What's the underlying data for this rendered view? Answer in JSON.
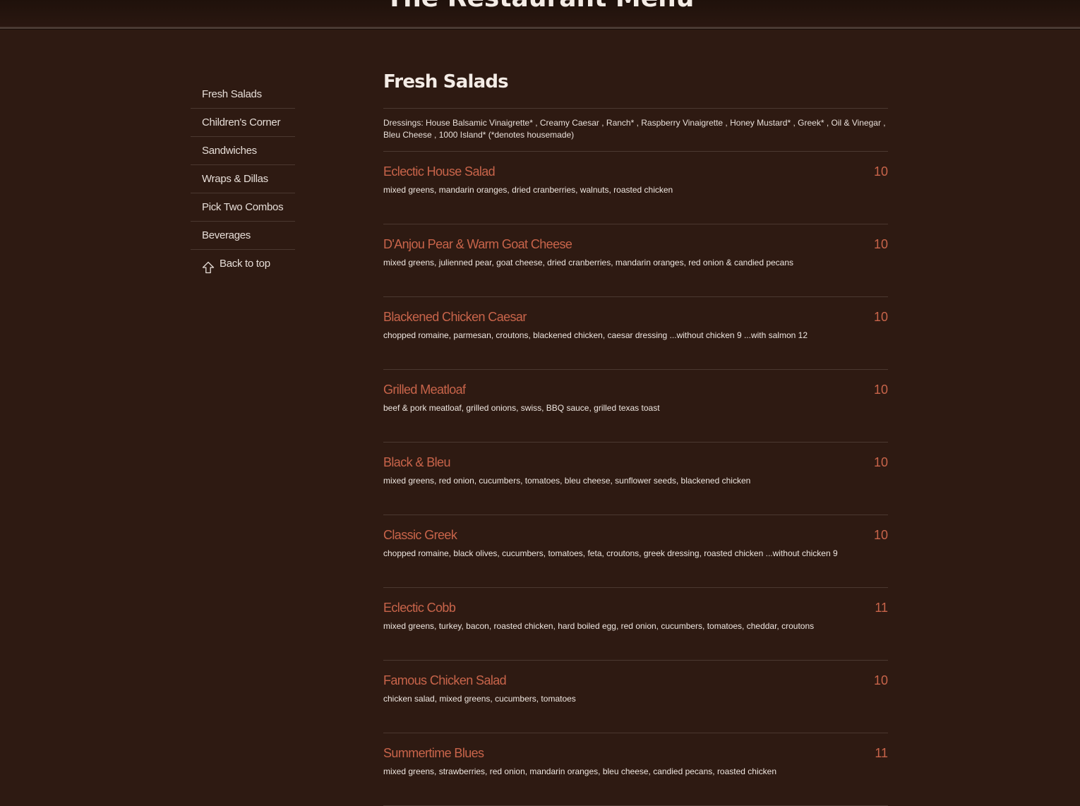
{
  "site": {
    "title": "The Restaurant Menu"
  },
  "colors": {
    "background": "#2e1a12",
    "accent": "#c8644a",
    "text": "#eee6e0"
  },
  "sidebar": {
    "items": [
      {
        "label": "Fresh Salads"
      },
      {
        "label": "Children's Corner"
      },
      {
        "label": "Sandwiches"
      },
      {
        "label": "Wraps & Dillas"
      },
      {
        "label": "Pick Two Combos"
      },
      {
        "label": "Beverages"
      }
    ],
    "back_to_top": {
      "label": "Back to top",
      "icon": "arrow-up-icon"
    }
  },
  "section": {
    "title": "Fresh Salads",
    "dressings": "Dressings: House Balsamic Vinaigrette* , Creamy Caesar , Ranch* , Raspberry Vinaigrette , Honey Mustard* , Greek* , Oil & Vinegar , Bleu Cheese , 1000 Island* (*denotes housemade)"
  },
  "items": [
    {
      "name": "Eclectic House Salad",
      "price": "10",
      "desc": "mixed greens, mandarin oranges, dried cranberries, walnuts, roasted chicken"
    },
    {
      "name": "D'Anjou Pear & Warm Goat Cheese",
      "price": "10",
      "desc": "mixed greens, julienned pear, goat cheese, dried cranberries, mandarin oranges, red onion & candied pecans"
    },
    {
      "name": "Blackened Chicken Caesar",
      "price": "10",
      "desc": "chopped romaine, parmesan, croutons, blackened chicken, caesar dressing ...without chicken 9 ...with salmon 12"
    },
    {
      "name": "Grilled Meatloaf",
      "price": "10",
      "desc": "beef & pork meatloaf, grilled onions, swiss, BBQ sauce, grilled texas toast"
    },
    {
      "name": "Black & Bleu",
      "price": "10",
      "desc": "mixed greens, red onion, cucumbers, tomatoes, bleu cheese, sunflower seeds, blackened chicken"
    },
    {
      "name": "Classic Greek",
      "price": "10",
      "desc": "chopped romaine, black olives, cucumbers, tomatoes, feta, croutons, greek dressing, roasted chicken ...without chicken 9"
    },
    {
      "name": "Eclectic Cobb",
      "price": "11",
      "desc": "mixed greens, turkey, bacon, roasted chicken, hard boiled egg, red onion, cucumbers, tomatoes, cheddar, croutons"
    },
    {
      "name": "Famous Chicken Salad",
      "price": "10",
      "desc": "chicken salad, mixed greens, cucumbers, tomatoes"
    },
    {
      "name": "Summertime Blues",
      "price": "11",
      "desc": "mixed greens, strawberries, red onion, mandarin oranges, bleu cheese, candied pecans, roasted chicken"
    }
  ]
}
